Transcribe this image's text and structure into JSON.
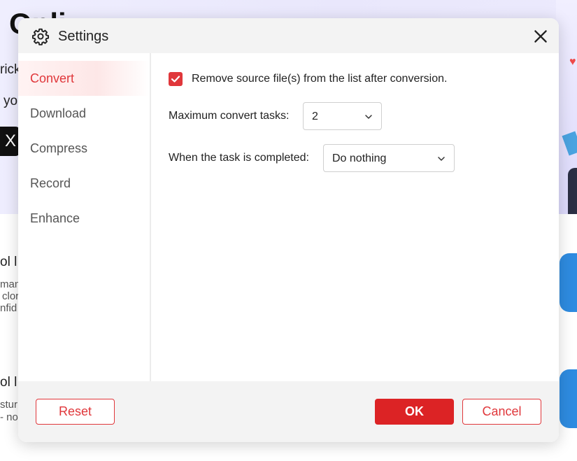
{
  "background": {
    "heading": "Onli",
    "line1": "rick",
    "line2": "yo",
    "x_button_label": "X",
    "section1": {
      "title": "ol l",
      "lines": [
        "man",
        "clor",
        "nfid"
      ]
    },
    "section2": {
      "title": "ol l",
      "lines": [
        "stur",
        "- no"
      ]
    }
  },
  "dialog": {
    "title": "Settings",
    "icons": {
      "title_icon": "gear-icon",
      "close": "close-icon"
    },
    "sidebar": {
      "items": [
        {
          "label": "Convert",
          "active": true
        },
        {
          "label": "Download",
          "active": false
        },
        {
          "label": "Compress",
          "active": false
        },
        {
          "label": "Record",
          "active": false
        },
        {
          "label": "Enhance",
          "active": false
        }
      ]
    },
    "convert": {
      "remove_source": {
        "label": "Remove source file(s) from the list after conversion.",
        "checked": true
      },
      "max_tasks": {
        "label": "Maximum convert tasks:",
        "value": "2"
      },
      "on_complete": {
        "label": "When the task is completed:",
        "value": "Do nothing"
      }
    },
    "footer": {
      "reset_label": "Reset",
      "ok_label": "OK",
      "cancel_label": "Cancel"
    }
  },
  "colors": {
    "accent": "#e0373b",
    "primary_button": "#dc2325",
    "header_bg": "#f3f3f3"
  }
}
